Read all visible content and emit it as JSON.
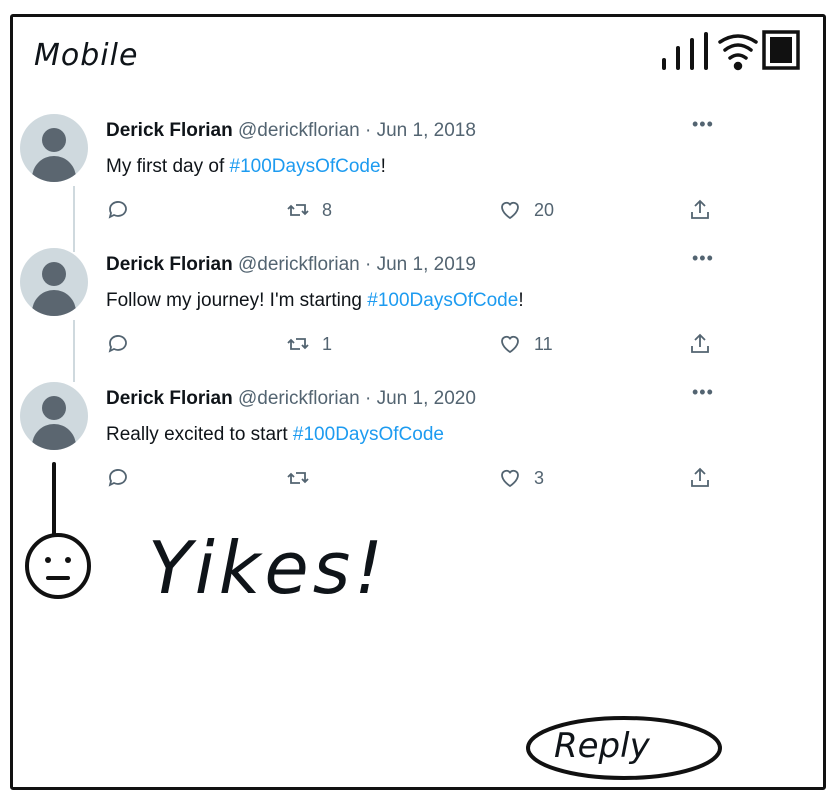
{
  "device": {
    "label": "Mobile"
  },
  "tweets": [
    {
      "author": "Derick Florian",
      "handle": "@derickflorian",
      "date": "· Jun 1, 2018",
      "text_before": "My first day of ",
      "hashtag": "#100DaysOfCode",
      "text_after": "!",
      "retweets": "8",
      "likes": "20"
    },
    {
      "author": "Derick Florian",
      "handle": "@derickflorian",
      "date": "· Jun 1, 2019",
      "text_before": "Follow my journey! I'm starting ",
      "hashtag": "#100DaysOfCode",
      "text_after": "!",
      "retweets": "1",
      "likes": "11"
    },
    {
      "author": "Derick Florian",
      "handle": "@derickflorian",
      "date": "· Jun 1, 2020",
      "text_before": "Really excited to start ",
      "hashtag": "#100DaysOfCode",
      "text_after": "",
      "retweets": "",
      "likes": "3"
    }
  ],
  "more_label": "•••",
  "annotation": {
    "text": "Yikes!"
  },
  "reply_button": {
    "label": "Reply"
  },
  "colors": {
    "accent": "#1d9bf0",
    "muted": "#536471",
    "avatar_bg": "#cfd9de"
  }
}
